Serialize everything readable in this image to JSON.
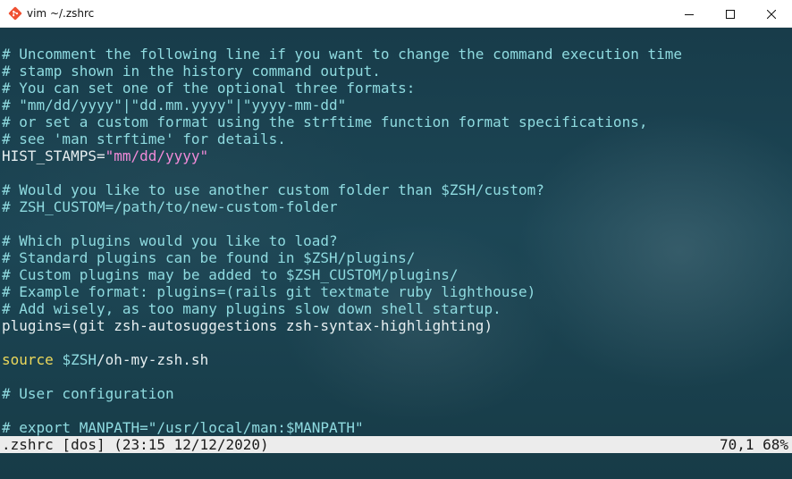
{
  "window": {
    "title": "vim ~/.zshrc",
    "app_icon": "git-logo-icon",
    "controls": [
      "minimize-icon",
      "maximize-icon",
      "close-icon"
    ]
  },
  "colors": {
    "comment": "#8fdbe0",
    "plain": "#e6eef0",
    "string": "#f08ad8",
    "keyword": "#ecd85b",
    "background": "#1c4655",
    "status_bg": "#ececec"
  },
  "editor": {
    "lines": [
      [
        {
          "t": "# Uncomment the following line if you want to change the command execution time",
          "k": "comment"
        }
      ],
      [
        {
          "t": "# stamp shown in the history command output.",
          "k": "comment"
        }
      ],
      [
        {
          "t": "# You can set one of the optional three formats:",
          "k": "comment"
        }
      ],
      [
        {
          "t": "# \"mm/dd/yyyy\"|\"dd.mm.yyyy\"|\"yyyy-mm-dd\"",
          "k": "comment"
        }
      ],
      [
        {
          "t": "# or set a custom format using the strftime function format specifications,",
          "k": "comment"
        }
      ],
      [
        {
          "t": "# see 'man strftime' for details.",
          "k": "comment"
        }
      ],
      [
        {
          "t": "HIST_STAMPS=",
          "k": "plain"
        },
        {
          "t": "\"mm/dd/yyyy\"",
          "k": "string"
        }
      ],
      [
        {
          "t": "",
          "k": "plain"
        }
      ],
      [
        {
          "t": "# Would you like to use another custom folder than $ZSH/custom?",
          "k": "comment"
        }
      ],
      [
        {
          "t": "# ZSH_CUSTOM=/path/to/new-custom-folder",
          "k": "comment"
        }
      ],
      [
        {
          "t": "",
          "k": "plain"
        }
      ],
      [
        {
          "t": "# Which plugins would you like to load?",
          "k": "comment"
        }
      ],
      [
        {
          "t": "# Standard plugins can be found in $ZSH/plugins/",
          "k": "comment"
        }
      ],
      [
        {
          "t": "# Custom plugins may be added to $ZSH_CUSTOM/plugins/",
          "k": "comment"
        }
      ],
      [
        {
          "t": "# Example format: plugins=(rails git textmate ruby lighthouse)",
          "k": "comment"
        }
      ],
      [
        {
          "t": "# Add wisely, as too many plugins slow down shell startup.",
          "k": "comment"
        }
      ],
      [
        {
          "t": "plugins=(git zsh-autosuggestions zsh-syntax-highlighting)",
          "k": "plain"
        }
      ],
      [
        {
          "t": "",
          "k": "plain"
        }
      ],
      [
        {
          "t": "source",
          "k": "keyword"
        },
        {
          "t": " ",
          "k": "plain"
        },
        {
          "t": "$ZSH",
          "k": "variable"
        },
        {
          "t": "/oh-my-zsh.sh",
          "k": "plain"
        }
      ],
      [
        {
          "t": "",
          "k": "plain"
        }
      ],
      [
        {
          "t": "# User configuration",
          "k": "comment"
        }
      ],
      [
        {
          "t": "",
          "k": "plain"
        }
      ],
      [
        {
          "t": "# export MANPATH=\"/usr/local/man:$MANPATH\"",
          "k": "comment"
        }
      ]
    ]
  },
  "statusline": {
    "left": ".zshrc [dos] (23:15 12/12/2020)",
    "right": "70,1 68%"
  }
}
